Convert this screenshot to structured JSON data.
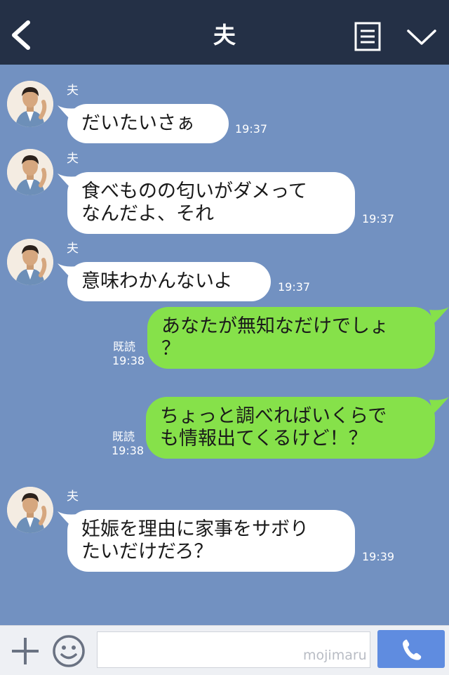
{
  "header": {
    "title": "夫"
  },
  "colors": {
    "header_bg": "#243046",
    "chat_bg": "#7291c1",
    "incoming_bubble": "#ffffff",
    "outgoing_bubble": "#86e14a",
    "call_button": "#5f8ce0"
  },
  "icons": {
    "back": "chevron-left-icon",
    "menu": "menu-icon",
    "collapse": "chevron-down-icon",
    "attach": "plus-icon",
    "emoji": "smiley-icon",
    "call": "phone-icon"
  },
  "messages": [
    {
      "sender": "夫",
      "text": "だいたいさぁ",
      "time": "19:37"
    },
    {
      "sender": "夫",
      "text": "食べものの匂いがダメって\nなんだよ、それ",
      "time": "19:37"
    },
    {
      "sender": "夫",
      "text": "意味わかんないよ",
      "time": "19:37"
    },
    {
      "text": "あなたが無知なだけでしょ\n？",
      "read": "既読",
      "time": "19:38"
    },
    {
      "text": "ちょっと調べればいくらで\nも情報出てくるけど！？",
      "read": "既読",
      "time": "19:38"
    },
    {
      "sender": "夫",
      "text": "妊娠を理由に家事をサボり\nたいだけだろ？",
      "time": "19:39"
    }
  ],
  "input": {
    "value": "",
    "watermark": "mojimaru"
  }
}
